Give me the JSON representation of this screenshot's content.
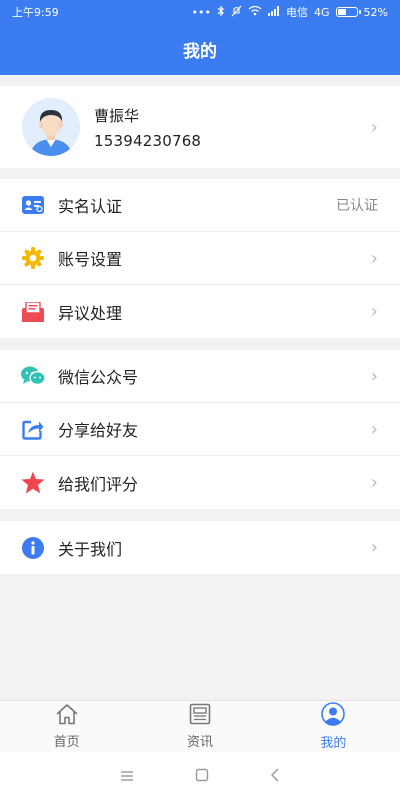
{
  "status_bar": {
    "time": "上午9:59",
    "carrier": "电信",
    "network": "4G",
    "battery": "52%",
    "battery_level": 0.52
  },
  "header": {
    "title": "我的"
  },
  "profile": {
    "name": "曹振华",
    "phone": "15394230768"
  },
  "menu_group_1": [
    {
      "label": "实名认证",
      "status": "已认证",
      "icon": "id-card-icon"
    },
    {
      "label": "账号设置",
      "icon": "gear-icon"
    },
    {
      "label": "异议处理",
      "icon": "mail-icon"
    }
  ],
  "menu_group_2": [
    {
      "label": "微信公众号",
      "icon": "wechat-icon"
    },
    {
      "label": "分享给好友",
      "icon": "share-icon"
    },
    {
      "label": "给我们评分",
      "icon": "star-icon"
    }
  ],
  "menu_group_3": [
    {
      "label": "关于我们",
      "icon": "info-icon"
    }
  ],
  "tabs": [
    {
      "label": "首页",
      "icon": "home-icon"
    },
    {
      "label": "资讯",
      "icon": "news-icon"
    },
    {
      "label": "我的",
      "icon": "profile-icon",
      "active": true
    }
  ],
  "colors": {
    "brand": "#3b7df0",
    "gear": "#f5b800",
    "mail": "#ee4b55",
    "wechat": "#2fc1b2",
    "star": "#f0454f",
    "info": "#3b7df0"
  }
}
